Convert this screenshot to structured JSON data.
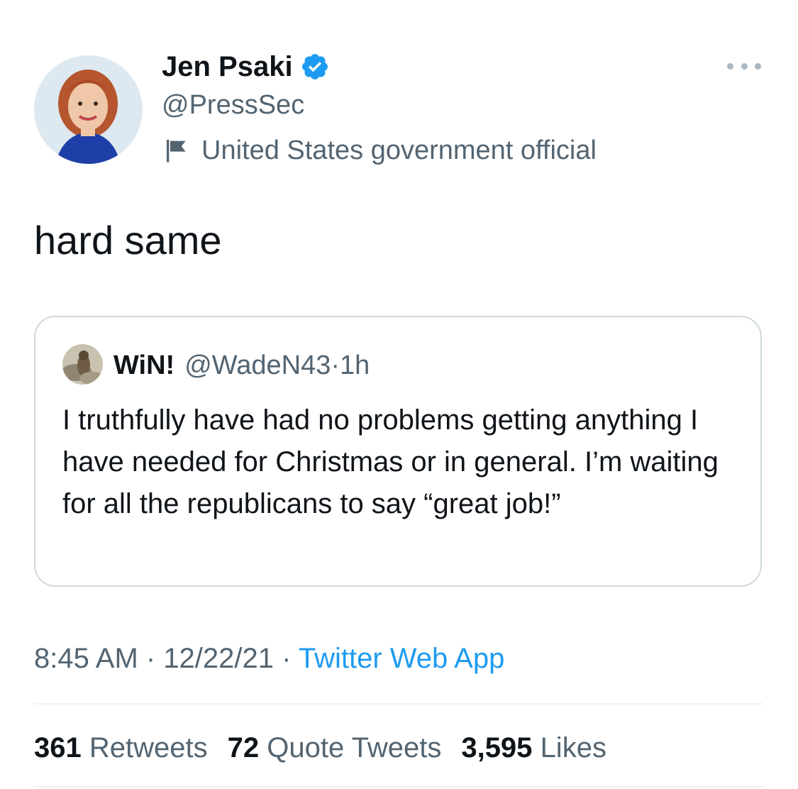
{
  "tweet": {
    "author": {
      "display_name": "Jen Psaki",
      "handle": "@PressSec",
      "verified": true,
      "label": "United States government official"
    },
    "text": "hard same",
    "timestamp": "8:45 AM",
    "date": "12/22/21",
    "separator": " · ",
    "source": "Twitter Web App"
  },
  "quoted_tweet": {
    "display_name": "WiN!",
    "handle": "@WadeN43",
    "age": "1h",
    "separator": " · ",
    "text": "I truthfully have had no problems getting anything I have needed for Christmas or in general. I’m waiting for all the republicans to say “great job!”"
  },
  "stats": {
    "retweets_count": "361",
    "retweets_label": "Retweets",
    "quotes_count": "72",
    "quotes_label": "Quote Tweets",
    "likes_count": "3,595",
    "likes_label": "Likes"
  },
  "icons": {
    "verified": "verified-badge-icon",
    "flag": "flag-icon",
    "more": "more-options-icon"
  },
  "colors": {
    "accent": "#1d9bf0",
    "secondary_text": "#536471",
    "primary_text": "#0f1419",
    "border": "#cfd9de"
  }
}
